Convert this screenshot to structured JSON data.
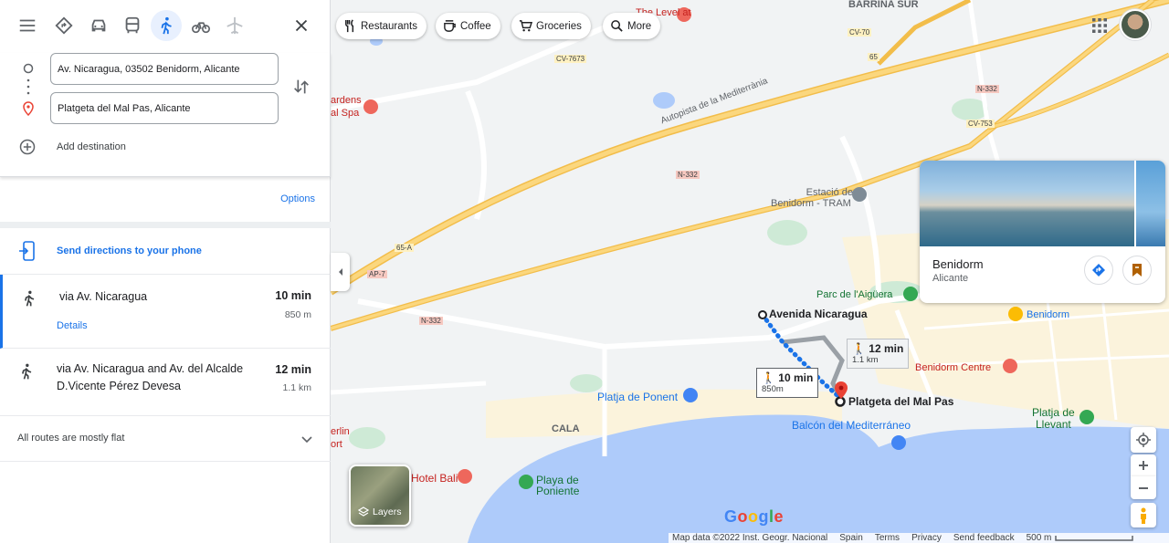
{
  "travel_modes": [
    {
      "name": "best",
      "icon": "directions-diamond-icon"
    },
    {
      "name": "driving",
      "icon": "car-icon"
    },
    {
      "name": "transit",
      "icon": "bus-icon"
    },
    {
      "name": "walking",
      "icon": "walk-icon",
      "active": true
    },
    {
      "name": "cycling",
      "icon": "bike-icon"
    },
    {
      "name": "flights",
      "icon": "plane-icon"
    }
  ],
  "origin": "Av. Nicaragua, 03502 Benidorm, Alicante",
  "destination": "Platgeta del Mal Pas, Alicante",
  "add_destination": "Add destination",
  "options_label": "Options",
  "send_directions": "Send directions to your phone",
  "routes": [
    {
      "via": "via Av. Nicaragua",
      "time": "10 min",
      "distance": "850 m",
      "details": "Details"
    },
    {
      "via": "via Av. Nicaragua and Av. del Alcalde D.Vicente Pérez Devesa",
      "time": "12 min",
      "distance": "1.1 km"
    }
  ],
  "flat_note": "All routes are mostly flat",
  "chips": [
    "Restaurants",
    "Coffee",
    "Groceries",
    "More"
  ],
  "place_card": {
    "title": "Benidorm",
    "subtitle": "Alicante"
  },
  "map_labels": {
    "barrina": "BARRINA SUR",
    "level": "The Level at",
    "cv70": "CV-70",
    "cv7673": "CV-7673",
    "r65": "65",
    "n332a": "N-332",
    "cv753": "CV-753",
    "autopista": "Autopista de la Mediterrània",
    "n332b": "N-332",
    "gardens": "ardens",
    "spa": "al Spa",
    "estacio1": "Estació de",
    "estacio2": "Benidorm - TRAM",
    "r65a": "65-A",
    "ap7": "AP-7",
    "n332c": "N-332",
    "parc": "Parc de l'Aigüera",
    "benidorm": "Benidorm",
    "avenida": "Avenida Nicaragua",
    "platgeta": "Platgeta del Mal Pas",
    "benidorm_centre": "Benidorm Centre",
    "ponent": "Platja de Ponent",
    "cala": "CALA",
    "balcon": "Balcón del Mediterráneo",
    "levant1": "Platja de",
    "levant2": "Llevant",
    "berlin1": "erlin",
    "berlin2": "ort",
    "hotel": "Hotel Bali",
    "playa1": "Playa de",
    "playa2": "Poniente"
  },
  "route_boxes": [
    {
      "time": "10 min",
      "distance": "850m"
    },
    {
      "time": "12 min",
      "distance": "1.1 km"
    }
  ],
  "layers_label": "Layers",
  "attribution": {
    "data": "Map data ©2022 Inst. Geogr. Nacional",
    "spain": "Spain",
    "terms": "Terms",
    "privacy": "Privacy",
    "feedback": "Send feedback",
    "scale": "500 m"
  },
  "google_logo": "Google",
  "colors": {
    "accent": "#1a73e8",
    "water": "#aecbfa",
    "road": "#f6c85f"
  }
}
